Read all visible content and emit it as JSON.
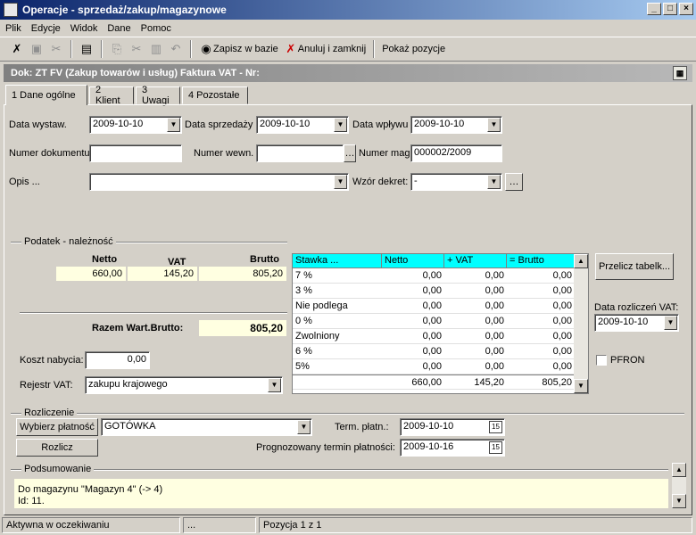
{
  "window": {
    "title": "Operacje - sprzedaż/zakup/magazynowe"
  },
  "menu": [
    "Plik",
    "Edycje",
    "Widok",
    "Dane",
    "Pomoc"
  ],
  "toolbar": {
    "save": "Zapisz w bazie",
    "cancel_close": "Anuluj i zamknij",
    "show_items": "Pokaż pozycje"
  },
  "doc_header": "Dok: ZT FV (Zakup towarów i usług)  Faktura VAT  -  Nr:",
  "tabs": [
    "1 Dane ogólne",
    "2 Klient",
    "3 Uwagi",
    "4 Pozostałe"
  ],
  "form": {
    "date_issued_label": "Data wystaw.",
    "date_issued": "2009-10-10",
    "date_sale_label": "Data sprzedaży",
    "date_sale": "2009-10-10",
    "date_received_label": "Data wpływu",
    "date_received": "2009-10-10",
    "doc_number_label": "Numer dokumentu",
    "doc_number": "",
    "internal_number_label": "Numer wewn.",
    "internal_number": "",
    "mag_number_label": "Numer mag.",
    "mag_number": "000002/2009",
    "description_label": "Opis ...",
    "description": "",
    "decree_label": "Wzór dekret:",
    "decree": "-"
  },
  "tax": {
    "group_label": "Podatek - należność",
    "netto_label": "Netto",
    "vat_label": "VAT",
    "brutto_label": "Brutto",
    "netto": "660,00",
    "vat": "145,20",
    "brutto": "805,20",
    "total_label": "Razem Wart.Brutto:",
    "total": "805,20",
    "grid_headers": [
      "Stawka ...",
      "Netto",
      "+ VAT",
      "= Brutto"
    ],
    "rows": [
      [
        "7 %",
        "0,00",
        "0,00",
        "0,00"
      ],
      [
        "3 %",
        "0,00",
        "0,00",
        "0,00"
      ],
      [
        "Nie podlega",
        "0,00",
        "0,00",
        "0,00"
      ],
      [
        "0 %",
        "0,00",
        "0,00",
        "0,00"
      ],
      [
        "Zwolniony",
        "0,00",
        "0,00",
        "0,00"
      ],
      [
        "6 %",
        "0,00",
        "0,00",
        "0,00"
      ],
      [
        "5%",
        "0,00",
        "0,00",
        "0,00"
      ]
    ],
    "totals_row": [
      "",
      "660,00",
      "145,20",
      "805,20"
    ],
    "recalc_button": "Przelicz tabelk...",
    "vat_settle_label": "Data rozliczeń VAT:",
    "vat_settle_date": "2009-10-10",
    "pfron_label": "PFRON"
  },
  "cost_label": "Koszt nabycia:",
  "cost": "0,00",
  "vat_register_label": "Rejestr VAT:",
  "vat_register": "zakupu krajowego",
  "settlement": {
    "group_label": "Rozliczenie",
    "choose_payment": "Wybierz płatność",
    "payment": "GOTÓWKA",
    "term_label": "Term. płatn.:",
    "term": "2009-10-10",
    "settle_button": "Rozlicz",
    "forecast_label": "Prognozowany termin płatności:",
    "forecast": "2009-10-16"
  },
  "summary": {
    "group_label": "Podsumowanie",
    "line1": "Do magazynu \"Magazyn 4\" (-> 4)",
    "line2": "Id: 11."
  },
  "status": {
    "state": "Aktywna w oczekiwaniu",
    "middle": "...",
    "position": "Pozycja 1 z 1"
  }
}
